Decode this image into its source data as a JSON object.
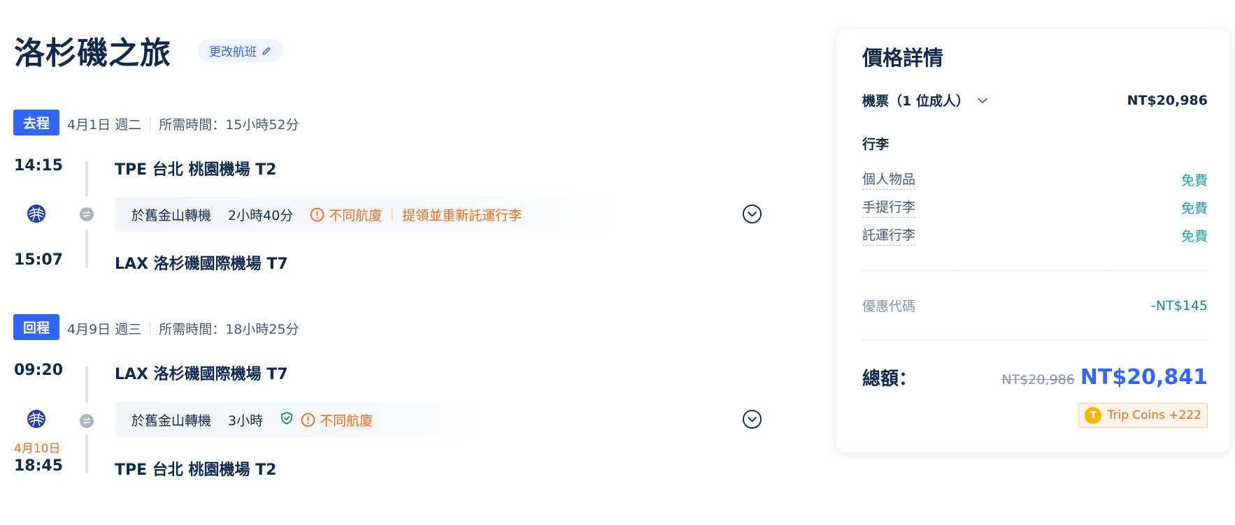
{
  "header": {
    "title": "洛杉磯之旅",
    "change_flight_label": "更改航班"
  },
  "outbound": {
    "badge": "去程",
    "date": "4月1日 週二",
    "duration": "所需時間：15小時52分",
    "depart_time": "14:15",
    "depart_airport": "TPE 台北 桃園機場 T2",
    "arrive_time": "15:07",
    "arrive_airport": "LAX 洛杉磯國際機場 T7",
    "transfer": {
      "city": "於舊金山轉機",
      "duration": "2小時40分",
      "warning": "不同航廈",
      "warning2": "提領並重新託運行李"
    }
  },
  "return": {
    "badge": "回程",
    "date": "4月9日 週三",
    "duration": "所需時間：18小時25分",
    "depart_time": "09:20",
    "depart_airport": "LAX 洛杉磯國際機場 T7",
    "arrive_next_day": "4月10日",
    "arrive_time": "18:45",
    "arrive_airport": "TPE 台北 桃園機場 T2",
    "transfer": {
      "city": "於舊金山轉機",
      "duration": "3小時",
      "warning": "不同航廈"
    }
  },
  "price": {
    "title": "價格詳情",
    "ticket_label": "機票（1 位成人）",
    "ticket_price": "NT$20,986",
    "baggage_title": "行李",
    "baggage": [
      {
        "label": "個人物品",
        "value": "免費"
      },
      {
        "label": "手提行李",
        "value": "免費"
      },
      {
        "label": "託運行李",
        "value": "免費"
      }
    ],
    "promo_label": "優惠代碼",
    "promo_value": "-NT$145",
    "total_label": "總額：",
    "original_total": "NT$20,986",
    "total": "NT$20,841",
    "coins": "Trip Coins +222",
    "coin_symbol": "T"
  },
  "colors": {
    "accent": "#3264ff",
    "warning": "#ed6b1e",
    "free": "#19a0a5",
    "text": "#0f294d"
  },
  "icons": [
    "pencil-icon",
    "united-airlines-logo",
    "transfer-icon",
    "warning-icon",
    "shield-icon",
    "chevron-down-circle-icon",
    "chevron-down-icon",
    "coin-icon"
  ]
}
